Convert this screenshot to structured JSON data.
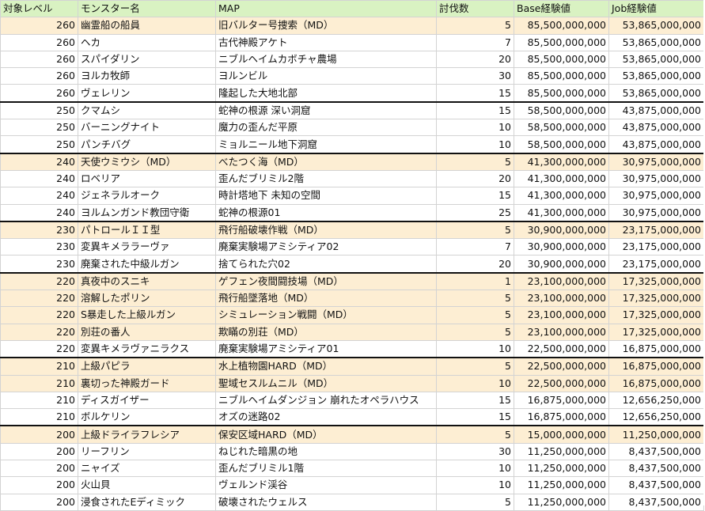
{
  "columns": [
    "対象レベル",
    "モンスター名",
    "MAP",
    "討伐数",
    "Base経験値",
    "Job経験値"
  ],
  "rows": [
    {
      "level": "260",
      "monster": "幽霊船の船員",
      "map": "旧バルター号捜索（MD）",
      "count": "5",
      "base": "85,500,000,000",
      "job": "53,865,000,000",
      "highlight": true,
      "group_start": false
    },
    {
      "level": "260",
      "monster": "ヘカ",
      "map": "古代神殿アケト",
      "count": "7",
      "base": "85,500,000,000",
      "job": "53,865,000,000",
      "highlight": false,
      "group_start": false
    },
    {
      "level": "260",
      "monster": "スパイダリン",
      "map": "ニブルヘイムカボチャ農場",
      "count": "20",
      "base": "85,500,000,000",
      "job": "53,865,000,000",
      "highlight": false,
      "group_start": false
    },
    {
      "level": "260",
      "monster": "ヨルカ牧師",
      "map": "ヨルンビル",
      "count": "30",
      "base": "85,500,000,000",
      "job": "53,865,000,000",
      "highlight": false,
      "group_start": false
    },
    {
      "level": "260",
      "monster": "ヴェレリン",
      "map": "隆起した大地北部",
      "count": "15",
      "base": "85,500,000,000",
      "job": "53,865,000,000",
      "highlight": false,
      "group_start": false
    },
    {
      "level": "250",
      "monster": "クマムシ",
      "map": "蛇神の根源 深い洞窟",
      "count": "15",
      "base": "58,500,000,000",
      "job": "43,875,000,000",
      "highlight": false,
      "group_start": true
    },
    {
      "level": "250",
      "monster": "バーニングナイト",
      "map": "魔力の歪んだ平原",
      "count": "10",
      "base": "58,500,000,000",
      "job": "43,875,000,000",
      "highlight": false,
      "group_start": false
    },
    {
      "level": "250",
      "monster": "パンチバグ",
      "map": "ミョルニール地下洞窟",
      "count": "10",
      "base": "58,500,000,000",
      "job": "43,875,000,000",
      "highlight": false,
      "group_start": false
    },
    {
      "level": "240",
      "monster": "天使ウミウシ（MD）",
      "map": "べたつく海（MD）",
      "count": "5",
      "base": "41,300,000,000",
      "job": "30,975,000,000",
      "highlight": true,
      "group_start": true
    },
    {
      "level": "240",
      "monster": "ロベリア",
      "map": "歪んだブリミル2階",
      "count": "20",
      "base": "41,300,000,000",
      "job": "30,975,000,000",
      "highlight": false,
      "group_start": false
    },
    {
      "level": "240",
      "monster": "ジェネラルオーク",
      "map": "時計塔地下 未知の空間",
      "count": "15",
      "base": "41,300,000,000",
      "job": "30,975,000,000",
      "highlight": false,
      "group_start": false
    },
    {
      "level": "240",
      "monster": "ヨルムンガンド教団守衛",
      "map": "蛇神の根源01",
      "count": "25",
      "base": "41,300,000,000",
      "job": "30,975,000,000",
      "highlight": false,
      "group_start": false
    },
    {
      "level": "230",
      "monster": "パトロールＩＩ型",
      "map": "飛行船破壊作戦（MD）",
      "count": "5",
      "base": "30,900,000,000",
      "job": "23,175,000,000",
      "highlight": true,
      "group_start": true
    },
    {
      "level": "230",
      "monster": "変異キメララーヴァ",
      "map": "廃棄実験場アミシティア02",
      "count": "7",
      "base": "30,900,000,000",
      "job": "23,175,000,000",
      "highlight": false,
      "group_start": false
    },
    {
      "level": "230",
      "monster": "廃棄された中級ルガン",
      "map": "捨てられた穴02",
      "count": "20",
      "base": "30,900,000,000",
      "job": "23,175,000,000",
      "highlight": false,
      "group_start": false
    },
    {
      "level": "220",
      "monster": "真夜中のスニキ",
      "map": "ゲフェン夜間闘技場（MD）",
      "count": "1",
      "base": "23,100,000,000",
      "job": "17,325,000,000",
      "highlight": true,
      "group_start": true
    },
    {
      "level": "220",
      "monster": "溶解したポリン",
      "map": "飛行船墜落地（MD）",
      "count": "5",
      "base": "23,100,000,000",
      "job": "17,325,000,000",
      "highlight": true,
      "group_start": false
    },
    {
      "level": "220",
      "monster": "S暴走した上級ルガン",
      "map": "シミュレーション戦闘（MD）",
      "count": "5",
      "base": "23,100,000,000",
      "job": "17,325,000,000",
      "highlight": true,
      "group_start": false
    },
    {
      "level": "220",
      "monster": "別荘の番人",
      "map": "欺瞞の別荘（MD）",
      "count": "5",
      "base": "23,100,000,000",
      "job": "17,325,000,000",
      "highlight": true,
      "group_start": false
    },
    {
      "level": "220",
      "monster": "変異キメラヴァニラクス",
      "map": "廃棄実験場アミシティア01",
      "count": "10",
      "base": "22,500,000,000",
      "job": "16,875,000,000",
      "highlight": false,
      "group_start": false
    },
    {
      "level": "210",
      "monster": "上級パピラ",
      "map": "水上植物園HARD（MD）",
      "count": "5",
      "base": "22,500,000,000",
      "job": "16,875,000,000",
      "highlight": true,
      "group_start": true
    },
    {
      "level": "210",
      "monster": "裏切った神殿ガード",
      "map": "聖域セスルムニル（MD）",
      "count": "10",
      "base": "22,500,000,000",
      "job": "16,875,000,000",
      "highlight": true,
      "group_start": false
    },
    {
      "level": "210",
      "monster": "ディスガイザー",
      "map": "ニブルヘイムダンジョン 崩れたオペラハウス",
      "count": "15",
      "base": "16,875,000,000",
      "job": "12,656,250,000",
      "highlight": false,
      "group_start": false
    },
    {
      "level": "210",
      "monster": "ボルケリン",
      "map": "オズの迷路02",
      "count": "15",
      "base": "16,875,000,000",
      "job": "12,656,250,000",
      "highlight": false,
      "group_start": false
    },
    {
      "level": "200",
      "monster": "上級ドライラフレシア",
      "map": "保安区域HARD（MD）",
      "count": "5",
      "base": "15,000,000,000",
      "job": "11,250,000,000",
      "highlight": true,
      "group_start": true
    },
    {
      "level": "200",
      "monster": "リーフリン",
      "map": "ねじれた暗黒の地",
      "count": "30",
      "base": "11,250,000,000",
      "job": "8,437,500,000",
      "highlight": false,
      "group_start": false
    },
    {
      "level": "200",
      "monster": "ニャイズ",
      "map": "歪んだブリミル1階",
      "count": "10",
      "base": "11,250,000,000",
      "job": "8,437,500,000",
      "highlight": false,
      "group_start": false
    },
    {
      "level": "200",
      "monster": "火山貝",
      "map": "ヴェルンド渓谷",
      "count": "10",
      "base": "11,250,000,000",
      "job": "8,437,500,000",
      "highlight": false,
      "group_start": false
    },
    {
      "level": "200",
      "monster": "浸食されたEディミック",
      "map": "破壊されたウェルス",
      "count": "5",
      "base": "11,250,000,000",
      "job": "8,437,500,000",
      "highlight": false,
      "group_start": false
    }
  ],
  "colors": {
    "header_bg": "#d9f2c2",
    "highlight_bg": "#fdeed3",
    "grid": "#d3d3d3",
    "group_border": "#111111"
  }
}
